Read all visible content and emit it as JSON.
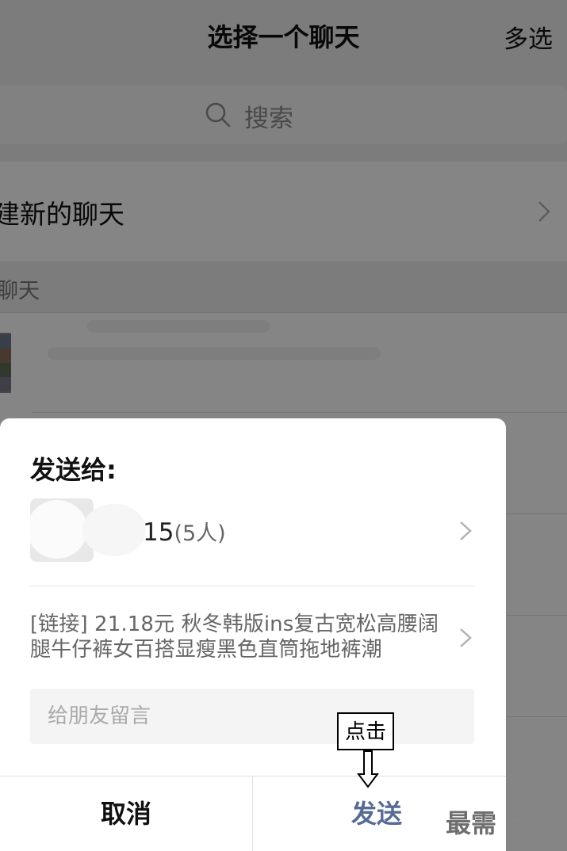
{
  "header": {
    "title": "选择一个聊天",
    "multi_select": "多选"
  },
  "search": {
    "placeholder": "搜索"
  },
  "new_chat": {
    "label": "建新的聊天"
  },
  "section": {
    "label": "聊天"
  },
  "dialog": {
    "title": "发送给:",
    "recipient": {
      "name": "15",
      "count": "(5人)"
    },
    "link_text": "[链接] 21.18元 秋冬韩版ins复古宽松高腰阔腿牛仔裤女百搭显瘦黑色直筒拖地裤潮",
    "message_placeholder": "给朋友留言",
    "cancel_label": "取消",
    "send_label": "发送"
  },
  "annotation": {
    "label": "点击"
  },
  "watermark": "最需",
  "colors": {
    "accent": "#576b95",
    "overlay": "rgba(0,0,0,0.48)"
  }
}
